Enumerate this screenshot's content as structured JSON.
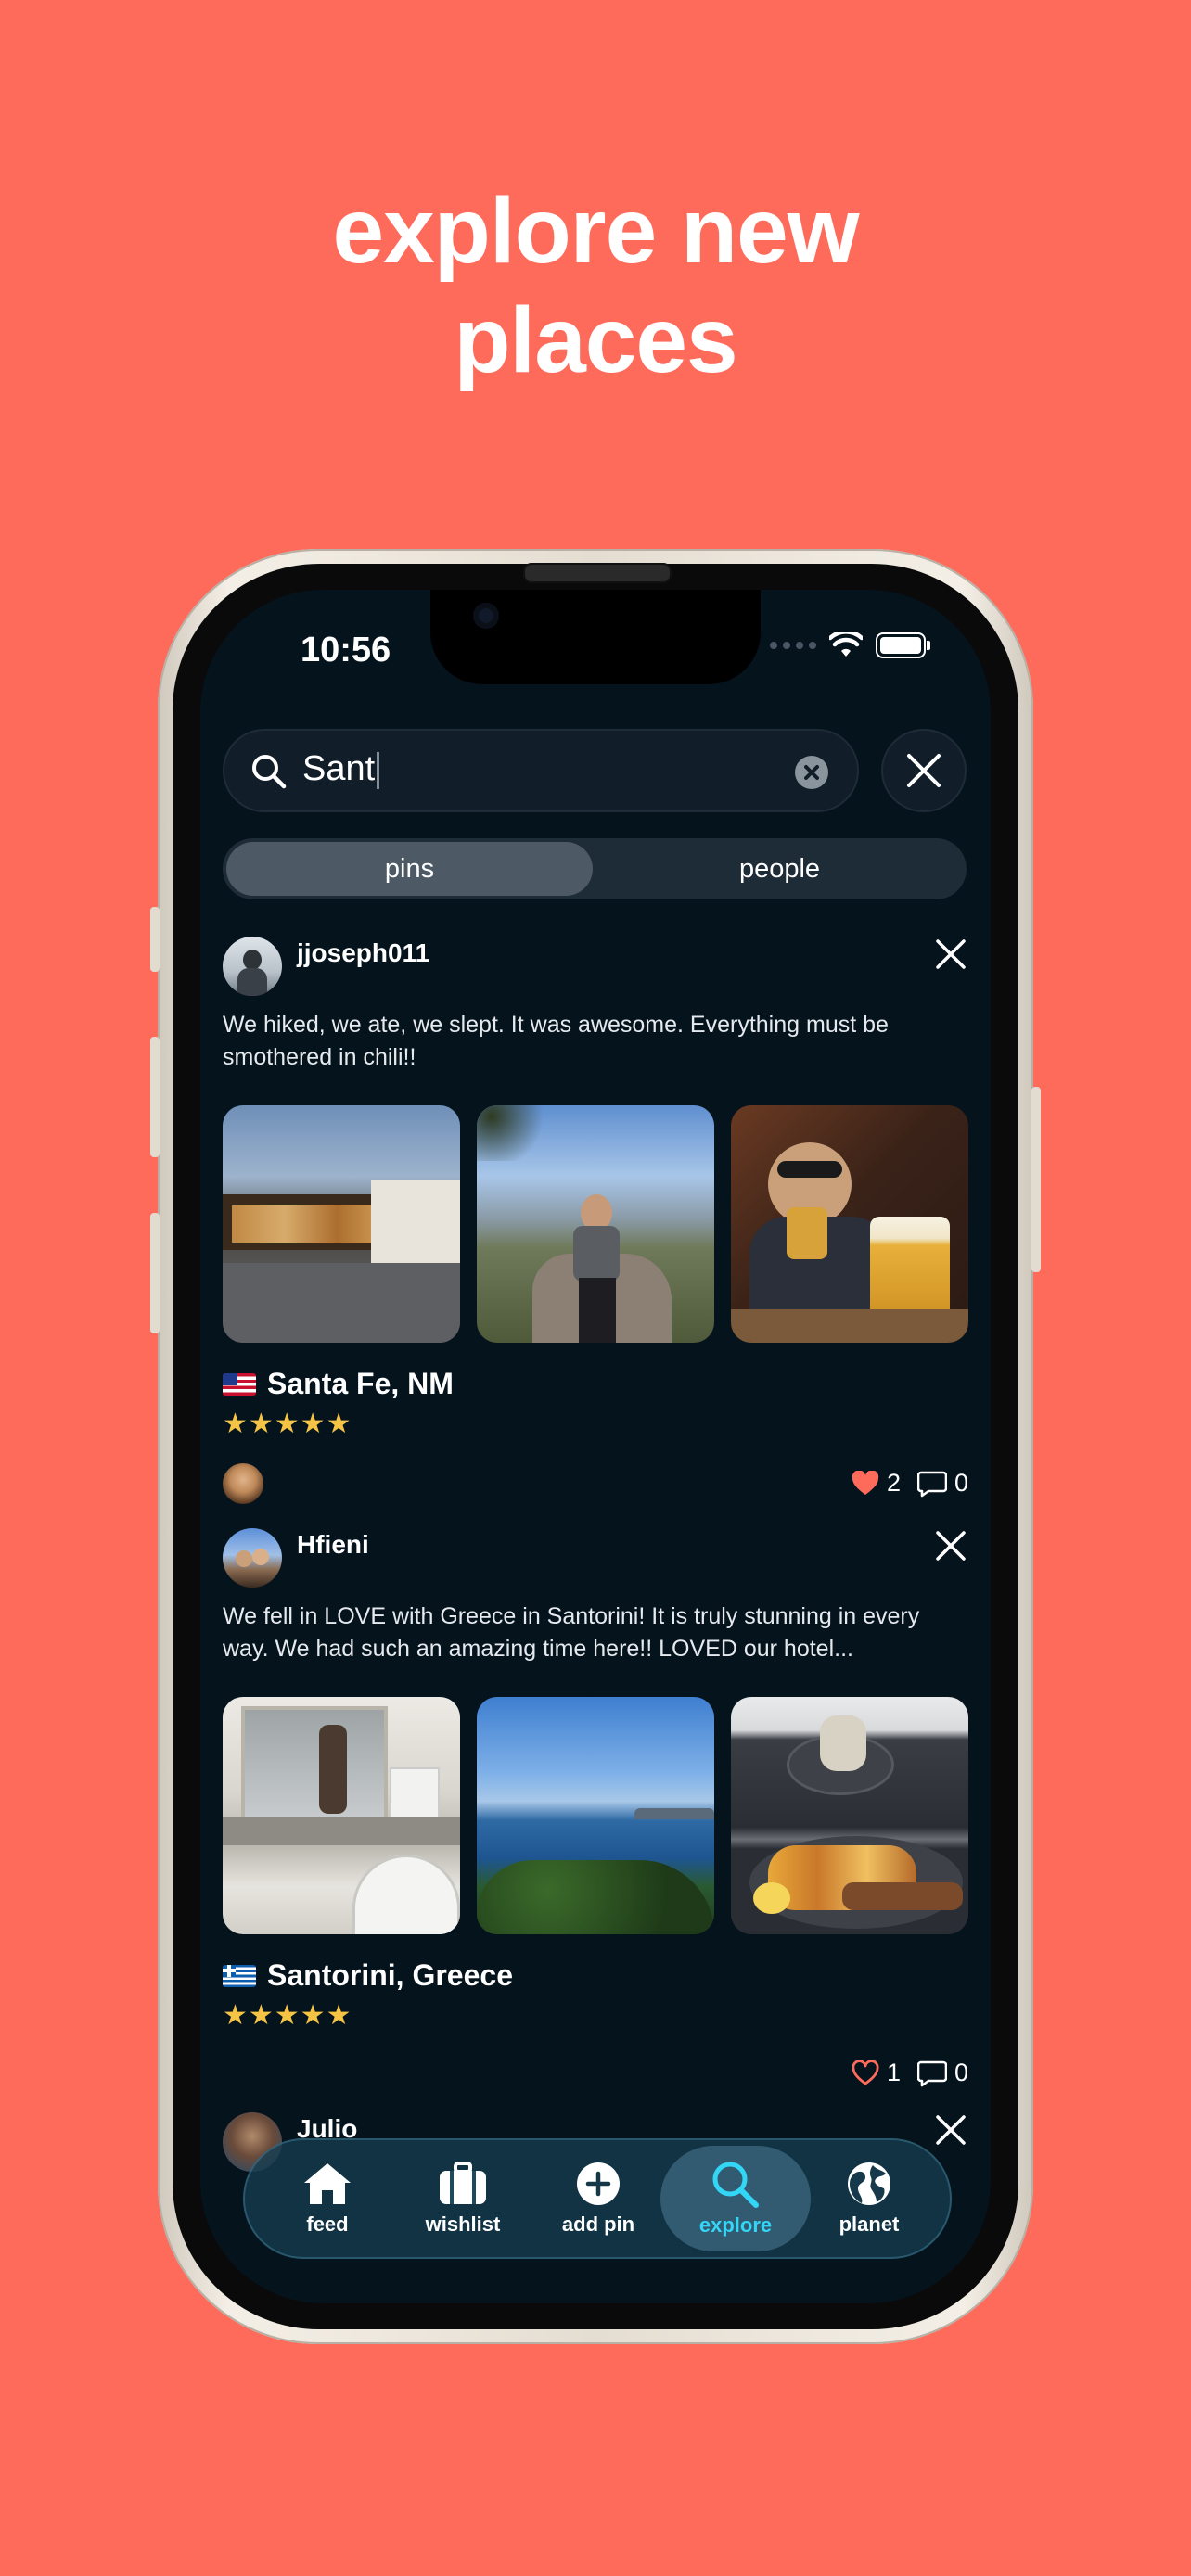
{
  "headline": {
    "line1": "explore new",
    "line2": "places"
  },
  "status": {
    "time": "10:56"
  },
  "search": {
    "query": "Sant"
  },
  "segments": {
    "pins": "pins",
    "people": "people",
    "active": "pins"
  },
  "posts": [
    {
      "username": "jjoseph011",
      "caption": "We hiked, we ate, we slept. It was awesome. Everything must be smothered in chili!!",
      "place": "Santa Fe, NM",
      "flag": "us-flag",
      "stars": "★★★★★",
      "likes": "2",
      "comments": "0",
      "liked": true
    },
    {
      "username": "Hfieni",
      "caption": "We fell in LOVE with Greece in Santorini! It is truly stunning in every way. We had such an amazing time here!! LOVED our hotel...",
      "place": "Santorini, Greece",
      "flag": "greece-flag",
      "stars": "★★★★★",
      "likes": "1",
      "comments": "0",
      "liked": false
    },
    {
      "username": "Julio"
    }
  ],
  "tabs": {
    "feed": "feed",
    "wishlist": "wishlist",
    "add_pin": "add pin",
    "explore": "explore",
    "planet": "planet",
    "active": "explore"
  },
  "colors": {
    "background": "#FF6B5B",
    "screen": "#05131D",
    "accent": "#33D6F5",
    "star": "#F6C445",
    "heart": "#FF6B5B"
  }
}
